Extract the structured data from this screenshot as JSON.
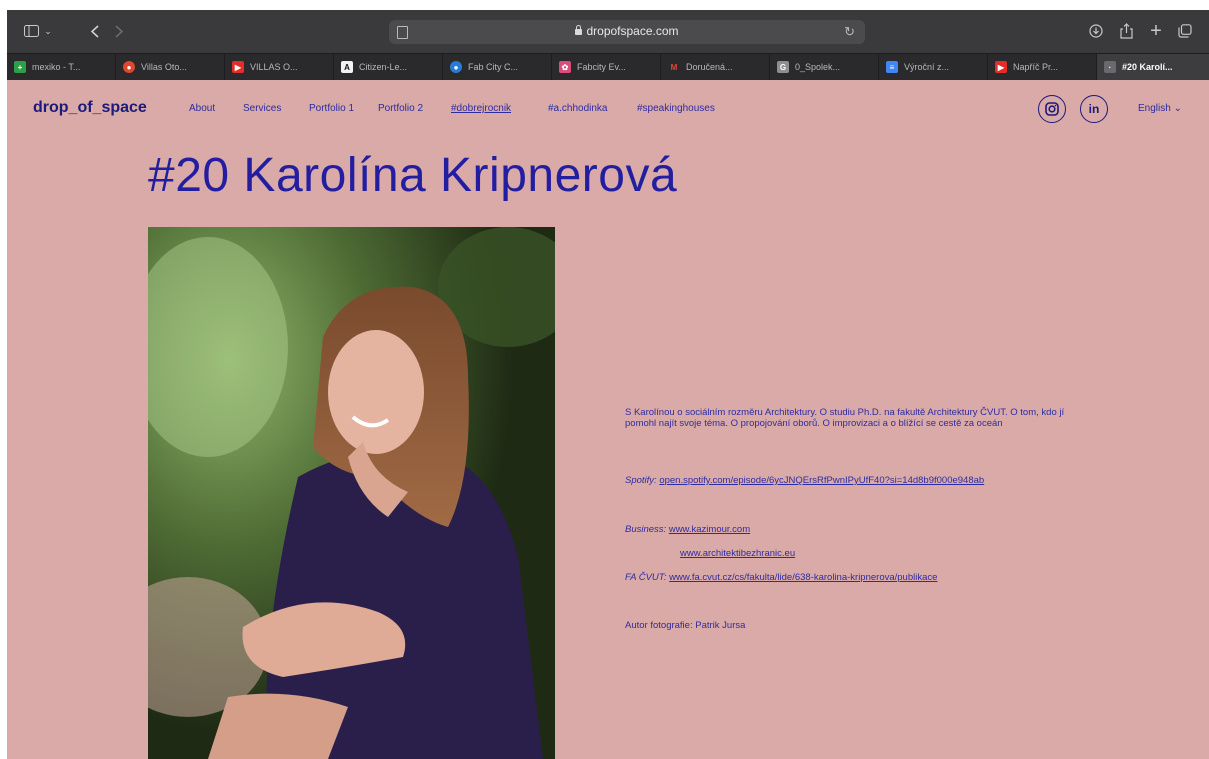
{
  "browser": {
    "url": "dropofspace.com",
    "tabs": [
      {
        "label": "mexiko - T...",
        "fav_color": "#2e9e48",
        "fav_glyph": "+"
      },
      {
        "label": "Villas Oto...",
        "fav_color": "#e0472b",
        "fav_glyph": "●"
      },
      {
        "label": "VILLAS O...",
        "fav_color": "#e52d27",
        "fav_glyph": "▶"
      },
      {
        "label": "Citizen-Le...",
        "fav_color": "#f2f2f2",
        "fav_glyph": "A"
      },
      {
        "label": "Fab City C...",
        "fav_color": "#2b7bd6",
        "fav_glyph": "●"
      },
      {
        "label": "Fabcity Ev...",
        "fav_color": "#d94d7a",
        "fav_glyph": "✿"
      },
      {
        "label": "Doručená...",
        "fav_color": "#ea4335",
        "fav_glyph": "M"
      },
      {
        "label": "0_Spolek...",
        "fav_color": "#8e8e93",
        "fav_glyph": "G"
      },
      {
        "label": "Výroční z...",
        "fav_color": "#4285f4",
        "fav_glyph": "≡"
      },
      {
        "label": "Napříč Pr...",
        "fav_color": "#e52d27",
        "fav_glyph": "▶"
      },
      {
        "label": "#20 Karolí...",
        "fav_color": "#6a6a6e",
        "fav_glyph": "·"
      }
    ]
  },
  "site": {
    "logo": "drop_of_space",
    "nav": [
      "About",
      "Services",
      "Portfolio 1",
      "Portfolio 2",
      "#dobrejrocnik",
      "#a.chhodinka",
      "#speakinghouses"
    ],
    "language": "English",
    "social": {
      "instagram": "instagram",
      "linkedin": "in"
    }
  },
  "page": {
    "title": "#20 Karolína Kripnerová",
    "description": "S Karolínou o sociálním rozměru Architektury. O studiu Ph.D. na fakultě Architektury ČVUT. O tom, kdo jí pomohl najít svoje téma. O propojování oborů. O improvizaci a o blížící se cestě za oceán",
    "spotify_label": "Spotify:",
    "spotify_link": "open.spotify.com/episode/6ycJNQErsRfPwnIPyUfF40?si=14d8b9f000e948ab",
    "business_label": "Business:",
    "business_link_1": "www.kazimour.com",
    "business_link_2": "www.architektibezhranic.eu",
    "facvut_label": "FA ČVUT:",
    "facvut_link": "www.fa.cvut.cz/cs/fakulta/lide/638-karolina-kripnerova/publikace",
    "photo_credit": "Autor fotografie: Patrik Jursa"
  }
}
